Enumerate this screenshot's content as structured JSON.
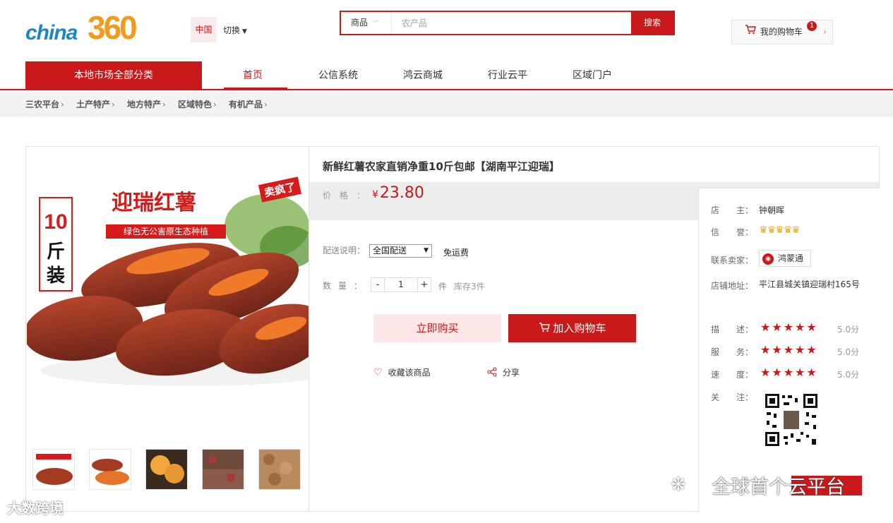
{
  "header": {
    "logo_text_a": "china",
    "logo_text_b": "360",
    "region": "中国",
    "switch_label": "切换",
    "search_category": "商品",
    "search_placeholder": "农产品",
    "search_button": "搜索",
    "cart_label": "我的购物车",
    "cart_count": "1"
  },
  "nav": {
    "all_categories": "本地市场全部分类",
    "items": [
      "首页",
      "公信系统",
      "鸿云商城",
      "行业云平",
      "区域门户"
    ]
  },
  "breadcrumb": [
    "三农平台",
    "土产特产",
    "地方特产",
    "区域特色",
    "有机产品"
  ],
  "product": {
    "title": "新鲜红薯农家直销净重10斤包邮【湖南平江迎瑞】",
    "price_label": "价格：",
    "currency": "¥",
    "price": "23.80",
    "shipping_label": "配送说明：",
    "shipping_option": "全国配送",
    "shipping_fee": "免运费",
    "qty_label": "数量：",
    "qty_value": "1",
    "qty_unit": "件",
    "stock": "库存3件",
    "buy_now": "立即购买",
    "add_to_cart": "加入购物车",
    "favorite": "收藏该商品",
    "share": "分享",
    "image": {
      "brand": "迎瑞红薯",
      "tagline": "绿色无公害原生态种植",
      "weight_1": "10",
      "weight_2": "斤",
      "weight_3": "装",
      "badge": "卖疯了"
    },
    "thumb_count": 5
  },
  "store": {
    "owner_label": "店　　主：",
    "owner": "钟朝晖",
    "credit_label": "信　　誉：",
    "credit_crowns": 5,
    "contact_label": "联系卖家：",
    "contact_button": "鸿蒙通",
    "address_label": "店铺地址：",
    "address": "平江县城关镇迎瑞村165号",
    "ratings": [
      {
        "label": "描　　述：",
        "score": "5.0分",
        "stars": 5
      },
      {
        "label": "服　　务：",
        "score": "5.0分",
        "stars": 5
      },
      {
        "label": "速　　度：",
        "score": "5.0分",
        "stars": 5
      }
    ],
    "follow_label": "关　　注："
  },
  "watermarks": {
    "wechat_text": "全球首个云平台",
    "corner_text": "大数跨境"
  }
}
